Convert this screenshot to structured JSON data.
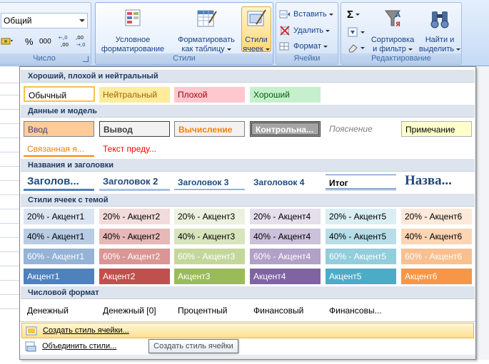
{
  "ribbon": {
    "number_group": {
      "label": "Число",
      "format_value": "Общий",
      "percent": "%",
      "thousands": "000",
      "inc_decimal": "+0 ,00",
      "dec_decimal": ",00 ,0"
    },
    "styles_group": {
      "label": "Стили",
      "conditional": "Условное\nформатирование",
      "conditional_l1": "Условное",
      "conditional_l2": "форматирование",
      "table_l1": "Форматировать",
      "table_l2": "как таблицу",
      "cell_l1": "Стили",
      "cell_l2": "ячеек"
    },
    "cells_group": {
      "label": "Ячейки",
      "insert": "Вставить",
      "delete": "Удалить",
      "format": "Формат"
    },
    "edit_group": {
      "label": "Редактирование",
      "sum": "Σ",
      "sort_l1": "Сортировка",
      "sort_l2": "и фильтр",
      "find_l1": "Найти и",
      "find_l2": "выделить"
    }
  },
  "gallery": {
    "sections": [
      {
        "title": "Хороший, плохой и нейтральный"
      },
      {
        "title": "Данные и модель"
      },
      {
        "title": "Названия и заголовки"
      },
      {
        "title": "Стили ячеек с темой"
      },
      {
        "title": "Числовой формат"
      }
    ],
    "good_bad": [
      "Обычный",
      "Нейтральный",
      "Плохой",
      "Хороший"
    ],
    "data_model_row1": [
      "Ввод",
      "Вывод",
      "Вычисление",
      "Контрольна...",
      "Пояснение",
      "Примечание"
    ],
    "data_model_row2": [
      "Связанная я...",
      "Текст преду..."
    ],
    "titles": [
      "Заголов...",
      "Заголовок 2",
      "Заголовок 3",
      "Заголовок 4",
      "Итог",
      "Назва..."
    ],
    "theme_20": [
      "20% - Акцент1",
      "20% - Акцент2",
      "20% - Акцент3",
      "20% - Акцент4",
      "20% - Акцент5",
      "20% - Акцент6"
    ],
    "theme_40": [
      "40% - Акцент1",
      "40% - Акцент2",
      "40% - Акцент3",
      "40% - Акцент4",
      "40% - Акцент5",
      "40% - Акцент6"
    ],
    "theme_60": [
      "60% - Акцент1",
      "60% - Акцент2",
      "60% - Акцент3",
      "60% - Акцент4",
      "60% - Акцент5",
      "60% - Акцент6"
    ],
    "theme_100": [
      "Акцент1",
      "Акцент2",
      "Акцент3",
      "Акцент4",
      "Акцент5",
      "Акцент6"
    ],
    "number_format": [
      "Денежный",
      "Денежный [0]",
      "Процентный",
      "Финансовый",
      "Финансовы..."
    ]
  },
  "commands": {
    "create_style": "Создать стиль ячейки...",
    "merge_styles": "Объединить стили..."
  },
  "tooltip": "Создать стиль ячейки",
  "colors": {
    "accent1": "#4f81bd",
    "accent2": "#c0504d",
    "accent3": "#9bbb59",
    "accent4": "#8064a2",
    "accent5": "#4bacc6",
    "accent6": "#f79646"
  }
}
